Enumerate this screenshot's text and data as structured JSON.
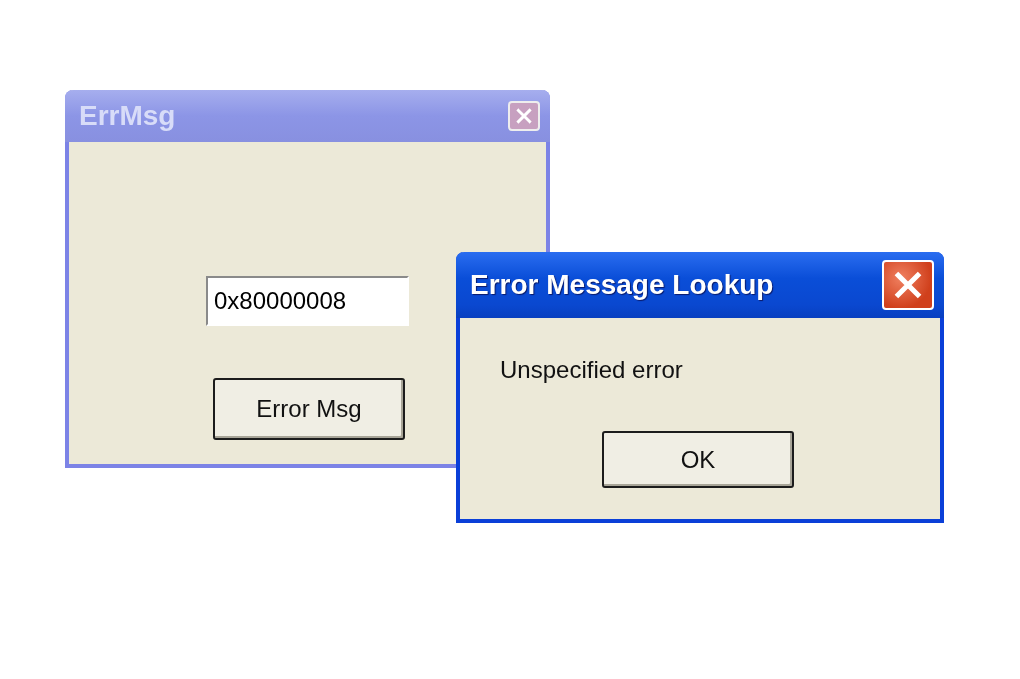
{
  "windows": [
    {
      "title": "ErrMsg",
      "active": false,
      "field": {
        "value": "0x80000008"
      },
      "button": "Error Msg"
    },
    {
      "title": "Error Message Lookup",
      "active": true,
      "message": "Unspecified error",
      "button": "OK"
    }
  ]
}
